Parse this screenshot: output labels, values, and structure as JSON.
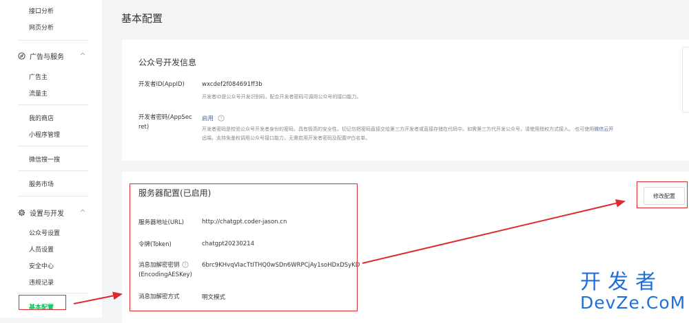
{
  "sidebar": {
    "top_items": [
      "接口分析",
      "网页分析"
    ],
    "group_ads": {
      "label": "广告与服务",
      "items": [
        "广告主",
        "流量主"
      ]
    },
    "misc_items": [
      "我的商店",
      "小程序管理",
      "微信搜一搜",
      "服务市场"
    ],
    "group_settings": {
      "label": "设置与开发",
      "items": [
        "公众号设置",
        "人员设置",
        "安全中心",
        "违规记录",
        "基本配置"
      ]
    }
  },
  "page_title": "基本配置",
  "dev_info": {
    "title": "公众号开发信息",
    "appid_label": "开发者ID(AppID)",
    "appid_value": "wxcdef2f084691ff3b",
    "appid_desc": "开发者ID是公众号开发识别码，配合开发者密码可调用公众号的接口能力。",
    "secret_label_line1": "开发者密码(AppSec",
    "secret_label_line2": "ret)",
    "secret_link": "启用",
    "secret_desc_line1": "开发者密码是校验公众号开发者身份的密码，具有极高的安全性。切记勿把密码直接交给第三方开发者或直接存储在代码中。如需第三方代开发公众号，请使用授权方式接入。 也可使用",
    "secret_desc_link": "微信云开",
    "secret_desc_line2": "远端，支持免鉴权调用公众号接口能力，无需启用开发者密码及配置IP白名单。"
  },
  "server_config": {
    "title": "服务器配置(已启用)",
    "modify_button": "修改配置",
    "rows": [
      {
        "label": "服务器地址(URL)",
        "value": "http://chatgpt.coder-jason.cn"
      },
      {
        "label": "令牌(Token)",
        "value": "chatgpt20230214"
      },
      {
        "label_line1": "消息加解密密钥",
        "label_line2": "(EncodingAESKey)",
        "value": "6brc9KHvqVIacTtITHQ0wSDn6WRPCjAy1soHDxDSyKD"
      },
      {
        "label": "消息加解密方式",
        "value": "明文模式"
      }
    ]
  },
  "watermark": {
    "cn": "开发者",
    "en": "DevZe.CoM"
  },
  "colors": {
    "accent_green": "#07c160",
    "annotation_red": "#e0282f",
    "link_blue": "#576b95",
    "watermark_blue": "#1e6fd9"
  }
}
